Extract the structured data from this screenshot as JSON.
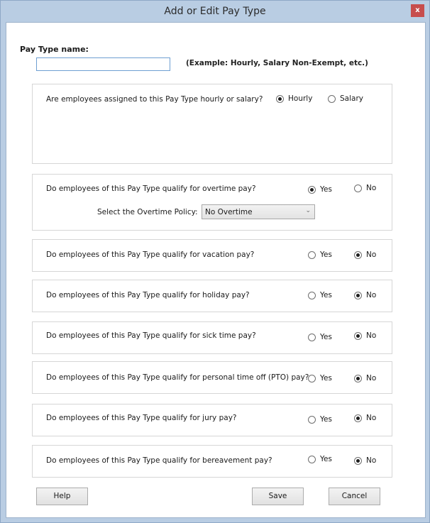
{
  "window": {
    "title": "Add or Edit Pay Type",
    "close_label": "x"
  },
  "pay_type_name": {
    "label": "Pay Type name:",
    "value": "",
    "placeholder": "",
    "example": "(Example:  Hourly, Salary Non-Exempt, etc.)"
  },
  "hourly_salary": {
    "question": "Are employees assigned to this Pay Type hourly or salary?",
    "options": [
      {
        "label": "Hourly",
        "selected": true
      },
      {
        "label": "Salary",
        "selected": false
      }
    ]
  },
  "overtime": {
    "question": "Do employees of this Pay Type qualify for overtime pay?",
    "yes_label": "Yes",
    "no_label": "No",
    "selected": "Yes",
    "policy_label": "Select the Overtime Policy:",
    "policy_value": "No Overtime"
  },
  "questions": [
    {
      "id": "vacation",
      "question": "Do employees of this Pay Type qualify for vacation pay?",
      "yes_label": "Yes",
      "no_label": "No",
      "selected": "No"
    },
    {
      "id": "holiday",
      "question": "Do employees of this Pay Type qualify for holiday pay?",
      "yes_label": "Yes",
      "no_label": "No",
      "selected": "No"
    },
    {
      "id": "sick",
      "question": "Do employees of this Pay Type qualify for sick time pay?",
      "yes_label": "Yes",
      "no_label": "No",
      "selected": "No"
    },
    {
      "id": "pto",
      "question": "Do employees of this Pay Type qualify for personal time off (PTO) pay?",
      "yes_label": "Yes",
      "no_label": "No",
      "selected": "No"
    },
    {
      "id": "jury",
      "question": "Do employees of this Pay Type qualify for jury pay?",
      "yes_label": "Yes",
      "no_label": "No",
      "selected": "No"
    },
    {
      "id": "bereavement",
      "question": "Do employees of this Pay Type qualify for bereavement pay?",
      "yes_label": "Yes",
      "no_label": "No",
      "selected": "No"
    }
  ],
  "buttons": {
    "help": "Help",
    "save": "Save",
    "cancel": "Cancel"
  }
}
